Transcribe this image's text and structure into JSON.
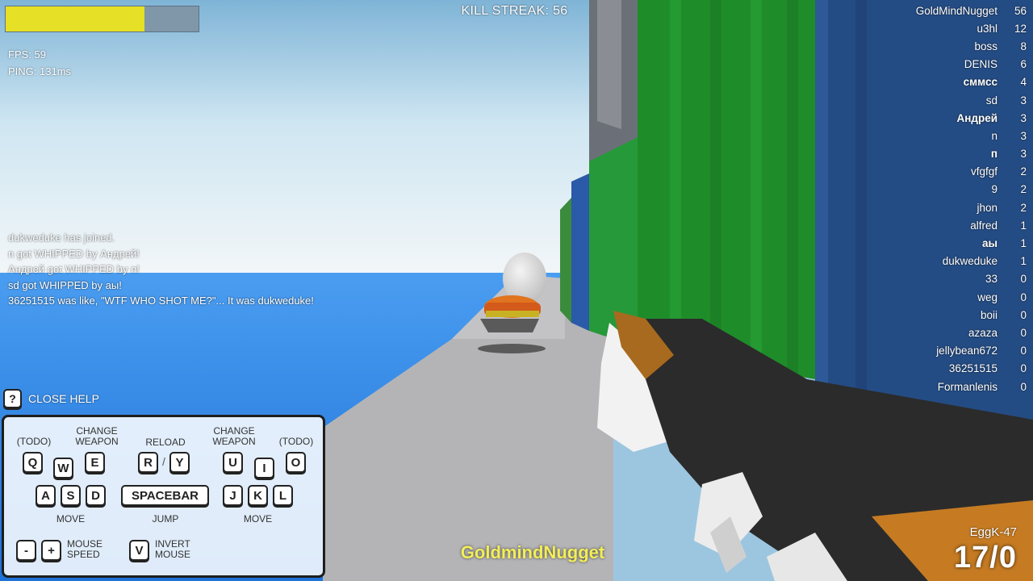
{
  "hud": {
    "health_fraction": 0.72,
    "fps": "FPS: 59",
    "ping": "PING: 131ms",
    "kill_streak": "KILL STREAK: 56",
    "player_name": "GoldmindNugget",
    "weapon_name": "EggK-47",
    "ammo": "17/0"
  },
  "killfeed": [
    "dukweduke has joined.",
    "n got WHIPPED by Андрей!",
    "Андрей got WHIPPED by n!",
    "sd got WHIPPED by аы!",
    "36251515 was like, \"WTF WHO SHOT ME?\"... It was dukweduke!"
  ],
  "scoreboard": [
    {
      "name": "GoldMindNugget",
      "score": "56",
      "bold": false
    },
    {
      "name": "u3hl",
      "score": "12",
      "bold": false
    },
    {
      "name": "boss",
      "score": "8",
      "bold": false
    },
    {
      "name": "DENIS",
      "score": "6",
      "bold": false
    },
    {
      "name": "сммсс",
      "score": "4",
      "bold": true
    },
    {
      "name": "sd",
      "score": "3",
      "bold": false
    },
    {
      "name": "Андрей",
      "score": "3",
      "bold": true
    },
    {
      "name": "n",
      "score": "3",
      "bold": false
    },
    {
      "name": "п",
      "score": "3",
      "bold": true
    },
    {
      "name": "vfgfgf",
      "score": "2",
      "bold": false
    },
    {
      "name": "9",
      "score": "2",
      "bold": false
    },
    {
      "name": "jhon",
      "score": "2",
      "bold": false
    },
    {
      "name": "alfred",
      "score": "1",
      "bold": false
    },
    {
      "name": "аы",
      "score": "1",
      "bold": true
    },
    {
      "name": "dukweduke",
      "score": "1",
      "bold": false
    },
    {
      "name": "33",
      "score": "0",
      "bold": false
    },
    {
      "name": "weg",
      "score": "0",
      "bold": false
    },
    {
      "name": "boii",
      "score": "0",
      "bold": false
    },
    {
      "name": "azaza",
      "score": "0",
      "bold": false
    },
    {
      "name": "jellybean672",
      "score": "0",
      "bold": false
    },
    {
      "name": "36251515",
      "score": "0",
      "bold": false
    },
    {
      "name": "Formanlenis",
      "score": "0",
      "bold": false
    }
  ],
  "help": {
    "toggle_key": "?",
    "toggle_label": "CLOSE HELP",
    "labels": {
      "todo_left": "(TODO)",
      "change_weapon_left_1": "CHANGE",
      "change_weapon_left_2": "WEAPON",
      "reload": "RELOAD",
      "change_weapon_right_1": "CHANGE",
      "change_weapon_right_2": "WEAPON",
      "todo_right": "(TODO)",
      "move_left": "MOVE",
      "jump": "JUMP",
      "move_right": "MOVE",
      "mouse_speed_1": "MOUSE",
      "mouse_speed_2": "SPEED",
      "invert_mouse_1": "INVERT",
      "invert_mouse_2": "MOUSE",
      "slash": "/"
    },
    "keys": {
      "q": "Q",
      "w": "W",
      "e": "E",
      "r": "R",
      "y": "Y",
      "u": "U",
      "i": "I",
      "o": "O",
      "a": "A",
      "s": "S",
      "d": "D",
      "space": "SPACEBAR",
      "j": "J",
      "k": "K",
      "l": "L",
      "minus": "-",
      "plus": "+",
      "v": "V"
    }
  },
  "colors": {
    "health": "#e6e026",
    "name_tag": "#f3ee57",
    "sky": "#bfe0f2",
    "sea": "#2e86e6",
    "road": "#b4b4b6",
    "container_green": "#1f8c2a",
    "container_blue": "#244c84"
  }
}
